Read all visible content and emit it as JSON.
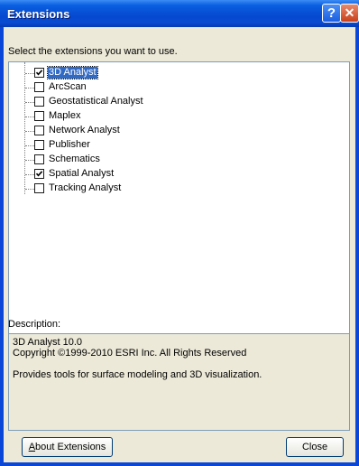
{
  "window": {
    "title": "Extensions",
    "help_glyph": "?",
    "close_glyph": "✕"
  },
  "instruction": "Select the extensions you want to use.",
  "extensions": [
    {
      "label": "3D Analyst",
      "checked": true,
      "selected": true
    },
    {
      "label": "ArcScan",
      "checked": false,
      "selected": false
    },
    {
      "label": "Geostatistical Analyst",
      "checked": false,
      "selected": false
    },
    {
      "label": "Maplex",
      "checked": false,
      "selected": false
    },
    {
      "label": "Network Analyst",
      "checked": false,
      "selected": false
    },
    {
      "label": "Publisher",
      "checked": false,
      "selected": false
    },
    {
      "label": "Schematics",
      "checked": false,
      "selected": false
    },
    {
      "label": "Spatial Analyst",
      "checked": true,
      "selected": false
    },
    {
      "label": "Tracking Analyst",
      "checked": false,
      "selected": false
    }
  ],
  "description": {
    "label": "Description:",
    "text": "3D Analyst 10.0\nCopyright ©1999-2010 ESRI Inc. All Rights Reserved\n\nProvides tools for surface modeling and 3D visualization."
  },
  "buttons": {
    "about": "About Extensions",
    "close": "Close"
  },
  "colors": {
    "titlebar": "#0549d1",
    "dialog_bg": "#ece9d8",
    "selection": "#316ac5",
    "field_border": "#7f9db9"
  }
}
